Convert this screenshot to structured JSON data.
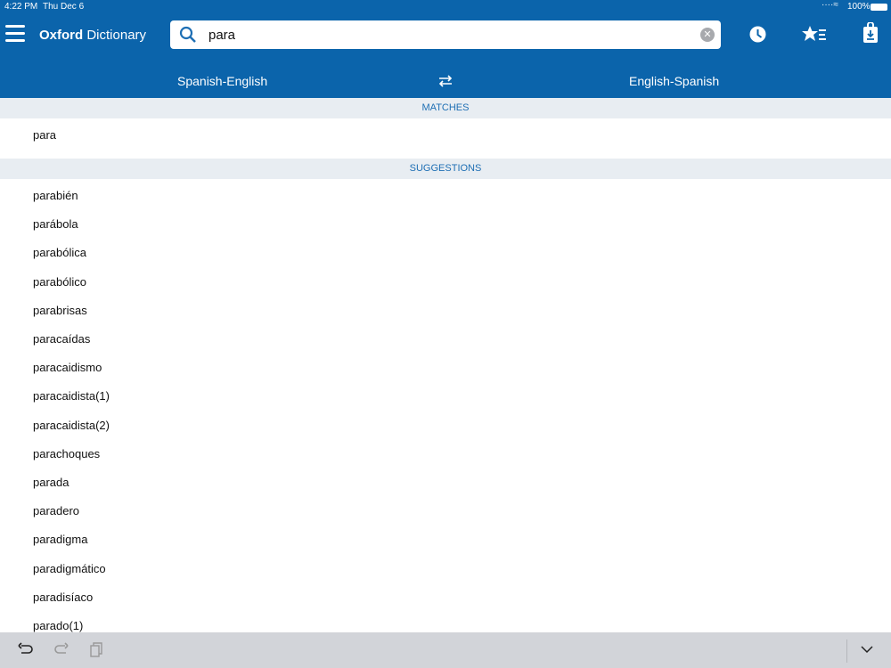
{
  "status": {
    "time": "4:22 PM",
    "date": "Thu Dec 6",
    "battery": "100%"
  },
  "header": {
    "title_bold": "Oxford",
    "title_rest": " Dictionary"
  },
  "search": {
    "value": "para"
  },
  "languages": {
    "left": "Spanish-English",
    "right": "English-Spanish"
  },
  "matches": {
    "header": "MATCHES",
    "items": [
      "para"
    ]
  },
  "suggestions": {
    "header": "SUGGESTIONS",
    "items": [
      "parabién",
      "parábola",
      "parabólica",
      "parabólico",
      "parabrisas",
      "paracaídas",
      "paracaidismo",
      "paracaidista(1)",
      "paracaidista(2)",
      "parachoques",
      "parada",
      "paradero",
      "paradigma",
      "paradigmático",
      "paradisíaco",
      "parado(1)"
    ]
  }
}
